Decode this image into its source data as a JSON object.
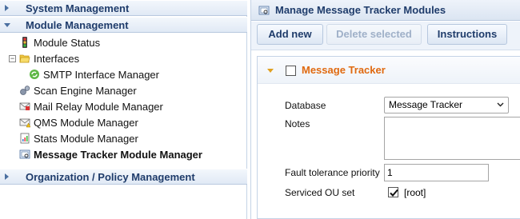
{
  "left": {
    "sections": {
      "system": "System Management",
      "module": "Module Management",
      "org": "Organization / Policy Management"
    },
    "tree": {
      "module_status": "Module Status",
      "interfaces": "Interfaces",
      "smtp": "SMTP Interface Manager",
      "scan": "Scan Engine Manager",
      "mail_relay": "Mail Relay Module Manager",
      "qms": "QMS Module Manager",
      "stats": "Stats Module Manager",
      "tracker": "Message Tracker Module Manager"
    }
  },
  "right": {
    "title": "Manage Message Tracker Modules",
    "toolbar": {
      "add": "Add new",
      "delete": "Delete selected",
      "instructions": "Instructions"
    },
    "module": {
      "name": "Message Tracker",
      "fields": {
        "database_label": "Database",
        "database_value": "Message Tracker",
        "notes_label": "Notes",
        "notes_value": "",
        "fault_label": "Fault tolerance priority",
        "fault_value": "1",
        "ou_label": "Serviced OU set",
        "ou_value": "[root]",
        "ou_checked": true
      }
    }
  },
  "colors": {
    "header_text": "#1f3c6b",
    "module_title": "#e06a10",
    "accent_arrow": "#e0a020"
  }
}
